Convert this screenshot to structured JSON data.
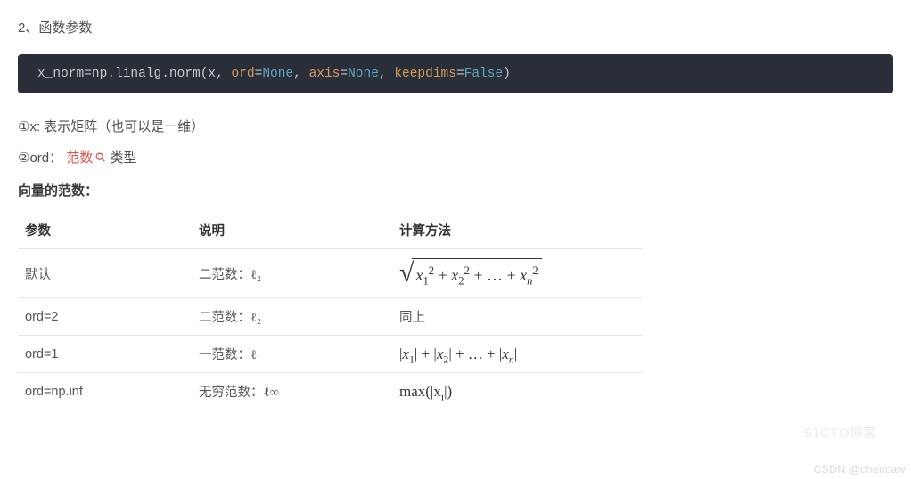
{
  "heading": "2、函数参数",
  "code": {
    "assign": "x_norm=np.linalg.norm(x, ",
    "p1": "ord",
    "eq": "=",
    "v_none1": "None",
    "sep1": ", ",
    "p2": "axis",
    "v_none2": "None",
    "sep2": ", ",
    "p3": "keepdims",
    "v_false": "False",
    "close": ")"
  },
  "params": {
    "line1_prefix": "①x: 表示矩阵（也可以是一维）",
    "line2_prefix": "②ord：",
    "line2_link": "范数",
    "line2_suffix": "类型"
  },
  "subhead": "向量的范数：",
  "table": {
    "headers": {
      "c1": "参数",
      "c2": "说明",
      "c3": "计算方法"
    },
    "rows": [
      {
        "param": "默认",
        "desc": "二范数：ℓ₂",
        "calc_key": "sqrt_sumsq"
      },
      {
        "param": "ord=2",
        "desc": "二范数：ℓ₂",
        "calc_key": "same_above"
      },
      {
        "param": "ord=1",
        "desc": "一范数：ℓ₁",
        "calc_key": "sum_abs"
      },
      {
        "param": "ord=np.inf",
        "desc": "无穷范数：ℓ∞",
        "calc_key": "max_abs"
      }
    ],
    "calc_labels": {
      "same_above": "同上"
    }
  },
  "watermarks": {
    "bottom": "CSDN @chencaw",
    "side": "51CTO博客"
  }
}
